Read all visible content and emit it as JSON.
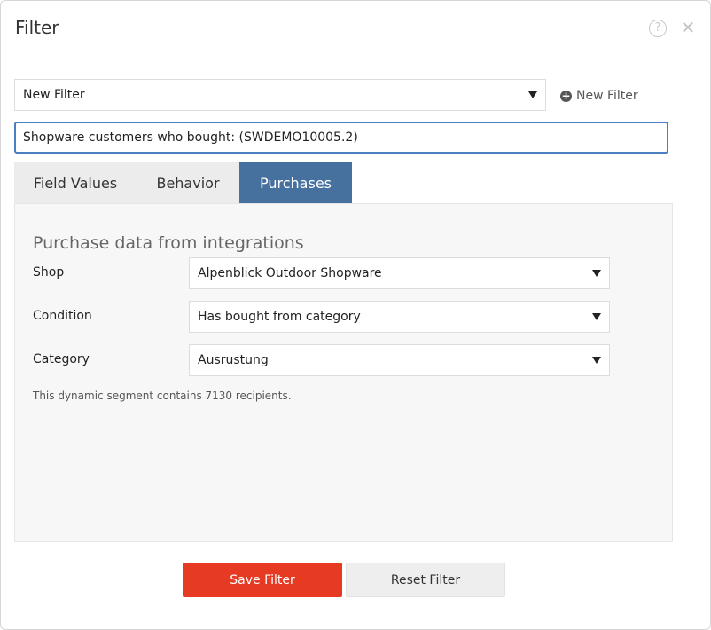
{
  "dialog": {
    "title": "Filter",
    "help_icon": "question-circle-icon",
    "close_icon": "close-icon",
    "help_glyph": "?",
    "close_glyph": "✕"
  },
  "filter_select": {
    "value": "New Filter"
  },
  "new_filter": {
    "label": "New Filter",
    "icon": "plus-circle-icon"
  },
  "name_input": {
    "value": "Shopware customers who bought: (SWDEMO10005.2)"
  },
  "tabs": [
    {
      "label": "Field Values",
      "active": false
    },
    {
      "label": "Behavior",
      "active": false
    },
    {
      "label": "Purchases",
      "active": true
    }
  ],
  "panel": {
    "heading": "Purchase data from integrations",
    "rows": [
      {
        "label": "Shop",
        "value": "Alpenblick Outdoor Shopware"
      },
      {
        "label": "Condition",
        "value": "Has bought from category"
      },
      {
        "label": "Category",
        "value": "Ausrustung"
      }
    ],
    "note": "This dynamic segment contains 7130 recipients."
  },
  "buttons": {
    "save": "Save Filter",
    "reset": "Reset Filter"
  },
  "colors": {
    "active_tab": "#46709e",
    "save_button": "#e73a23",
    "input_focus": "#4a7fc1"
  }
}
